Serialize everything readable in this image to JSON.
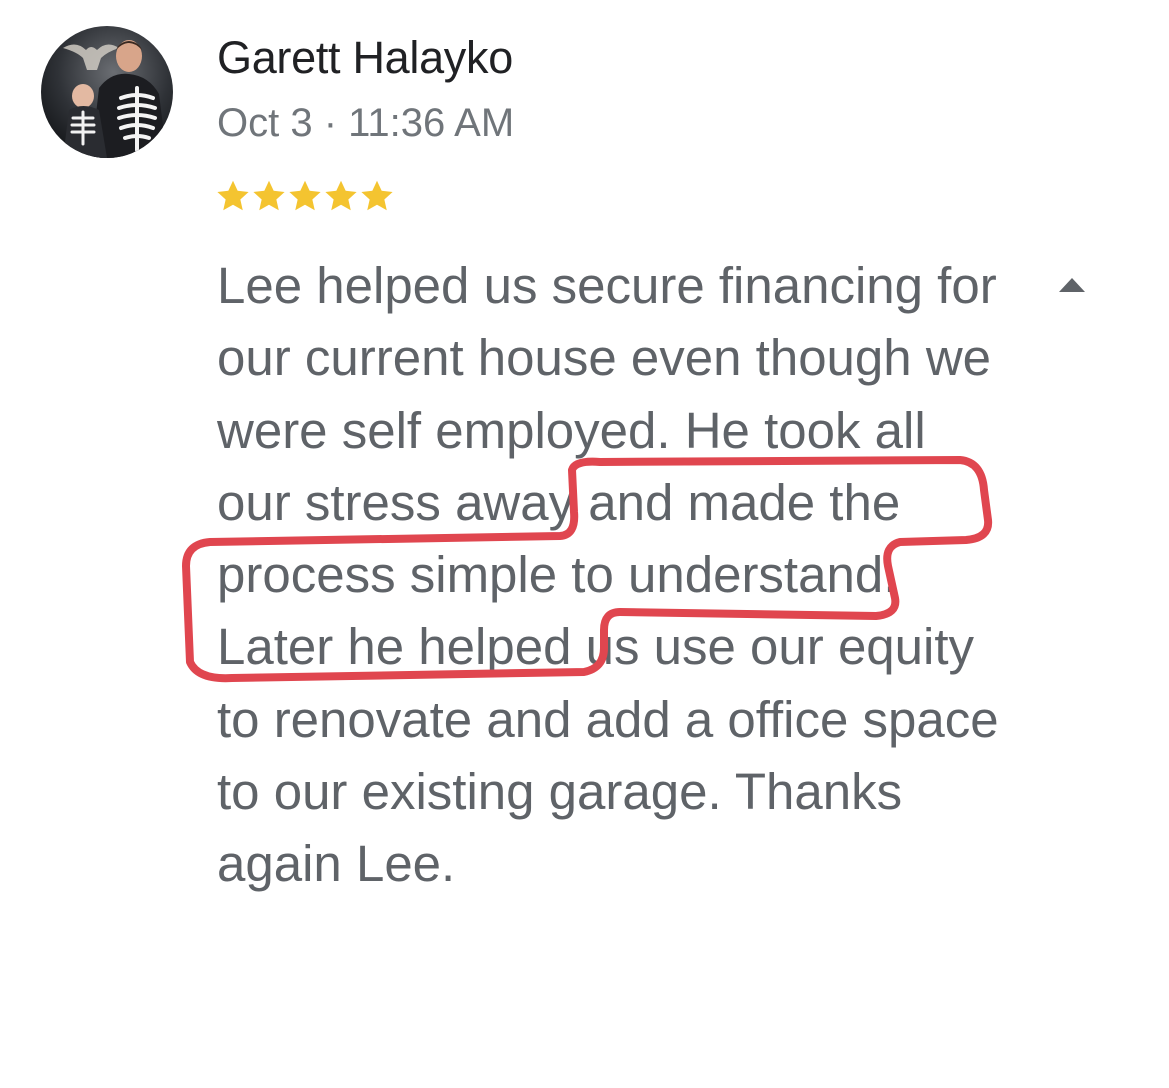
{
  "review": {
    "author_name": "Garett Halayko",
    "date_time": "Oct 3 · 11:36 AM",
    "rating": 5,
    "max_rating": 5,
    "body_text": "Lee helped us secure financing for our current house even though we were self employed. He took all our stress away and made the process simple to understand. Later he helped us use our equity to renovate and add a office space to our existing garage. Thanks again Lee.",
    "collapse_icon": "triangle-up-icon"
  },
  "colors": {
    "author": "#202124",
    "meta": "#70757a",
    "body": "#5f6368",
    "star": "#f4c430",
    "annotation": "#e0464f",
    "toggle": "#5f6368"
  }
}
